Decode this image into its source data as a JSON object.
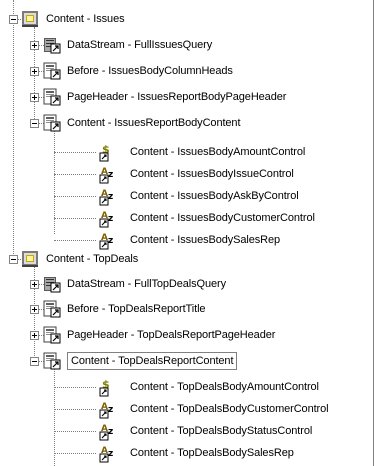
{
  "tree": {
    "nodes": [
      {
        "label": "Content - Issues",
        "kind": "group",
        "expander": "minus"
      },
      {
        "label": "DataStream - FullIssuesQuery",
        "kind": "datastream",
        "expander": "plus"
      },
      {
        "label": "Before - IssuesBodyColumnHeads",
        "kind": "section",
        "expander": "plus"
      },
      {
        "label": "PageHeader - IssuesReportBodyPageHeader",
        "kind": "section",
        "expander": "plus"
      },
      {
        "label": "Content - IssuesReportBodyContent",
        "kind": "section",
        "expander": "minus"
      },
      {
        "label": "Content - IssuesBodyAmountControl",
        "kind": "dollar-field"
      },
      {
        "label": "Content - IssuesBodyIssueControl",
        "kind": "text-field"
      },
      {
        "label": "Content - IssuesBodyAskByControl",
        "kind": "text-field"
      },
      {
        "label": "Content - IssuesBodyCustomerControl",
        "kind": "text-field"
      },
      {
        "label": "Content - IssuesBodySalesRep",
        "kind": "text-field"
      },
      {
        "label": "Content - TopDeals",
        "kind": "group",
        "expander": "minus"
      },
      {
        "label": "DataStream - FullTopDealsQuery",
        "kind": "datastream",
        "expander": "plus"
      },
      {
        "label": "Before - TopDealsReportTitle",
        "kind": "section",
        "expander": "plus"
      },
      {
        "label": "PageHeader - TopDealsReportPageHeader",
        "kind": "section",
        "expander": "plus"
      },
      {
        "label": "Content - TopDealsReportContent",
        "kind": "section",
        "expander": "minus",
        "selected": true
      },
      {
        "label": "Content - TopDealsBodyAmountControl",
        "kind": "dollar-field"
      },
      {
        "label": "Content - TopDealsBodyCustomerControl",
        "kind": "text-field"
      },
      {
        "label": "Content - TopDealsBodyStatusControl",
        "kind": "text-field"
      },
      {
        "label": "Content - TopDealsBodySalesRep",
        "kind": "text-field"
      }
    ]
  },
  "colors": {
    "group_icon": "#c8a800",
    "datastream_icon": "#808080",
    "dollar": "#808000",
    "text_field_ab": "#806000",
    "selection_border": "#808080"
  }
}
